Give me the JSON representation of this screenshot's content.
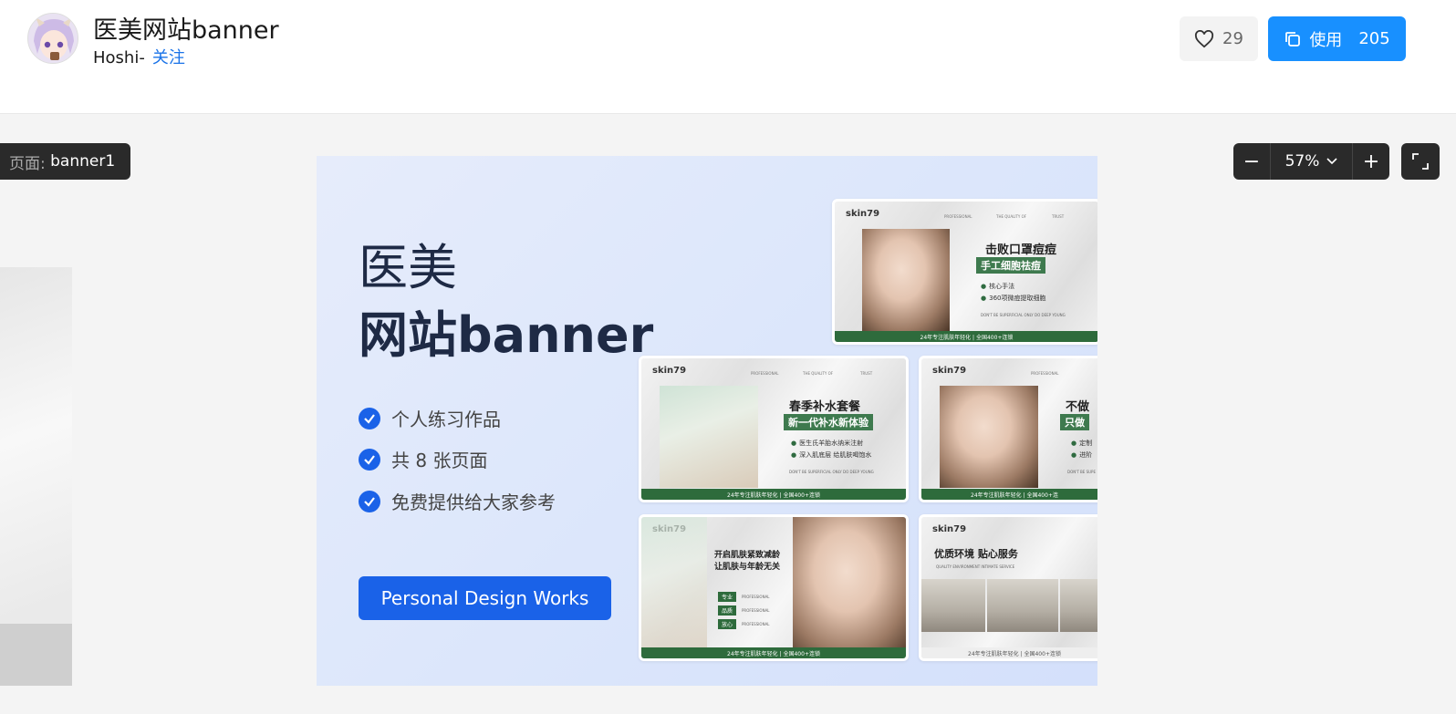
{
  "header": {
    "title": "医美网站banner",
    "author": "Hoshi-",
    "follow_label": "关注",
    "like_count": "29",
    "use_label": "使用",
    "use_count": "205"
  },
  "canvas": {
    "page_label": "页面:",
    "page_name": "banner1",
    "zoom_minus": "−",
    "zoom_value": "57%",
    "zoom_plus": "+"
  },
  "artboard": {
    "title_line1": "医美",
    "title_line2": "网站banner",
    "features": [
      "个人练习作品",
      "共 8 张页面",
      "免费提供给大家参考"
    ],
    "cta": "Personal Design Works"
  },
  "thumbs": {
    "brand": "skin79",
    "nav": [
      "PROFESSIONAL",
      "THE QUALITY OF",
      "TRUST"
    ],
    "t1": {
      "h1": "击败口罩痘痘",
      "h2": "手工细胞祛痘",
      "li1": "核心手法",
      "li2": "360项微痘提取细胞",
      "small": "DON'T BE SUPERFICIAL ONLY DO DEEP YOUNG",
      "foot": "24年专注肌肤年轻化 | 全国400+连锁"
    },
    "t2": {
      "h1": "春季补水套餐",
      "h2": "新一代补水新体验",
      "li1": "医生氏羊胎水纳米注射",
      "li2": "深入肌底层 给肌肤喝饱水",
      "small": "DON'T BE SUPERFICIAL ONLY DO DEEP YOUNG",
      "foot": "24年专注肌肤年轻化 | 全国400+连锁"
    },
    "t3": {
      "h1": "不做",
      "h2": "只做",
      "li1": "定制",
      "li2": "进阶",
      "small": "DON'T BE SUPE",
      "foot": "24年专注肌肤年轻化 | 全国400+连"
    },
    "t4": {
      "h1a": "开启肌肤紧致减龄",
      "h1b": "让肌肤与年龄无关",
      "tags": [
        "专业",
        "品质",
        "放心"
      ],
      "tag_sub": "PROFESSIONAL",
      "foot": "24年专注肌肤年轻化 | 全国400+连锁"
    },
    "t5": {
      "h1": "优质环境 贴心服务",
      "small": "QUALITY ENVIRONMENT INTIMATE SERVICE",
      "foot": "24年专注肌肤年轻化 | 全国400+连锁"
    }
  }
}
